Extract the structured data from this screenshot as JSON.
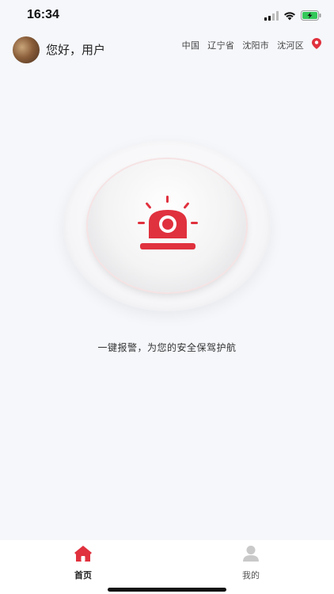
{
  "status_bar": {
    "time": "16:34"
  },
  "header": {
    "greeting": "您好，用户",
    "location": {
      "country": "中国",
      "province": "辽宁省",
      "city": "沈阳市",
      "district": "沈河区"
    }
  },
  "alarm": {
    "slogan": "一键报警，为您的安全保驾护航"
  },
  "tabs": [
    {
      "label": "首页",
      "icon": "home-icon",
      "active": true
    },
    {
      "label": "我的",
      "icon": "user-icon",
      "active": false
    }
  ],
  "colors": {
    "accent": "#e0313e",
    "background": "#f5f7fb",
    "inactive_icon": "#c9c9c9"
  }
}
